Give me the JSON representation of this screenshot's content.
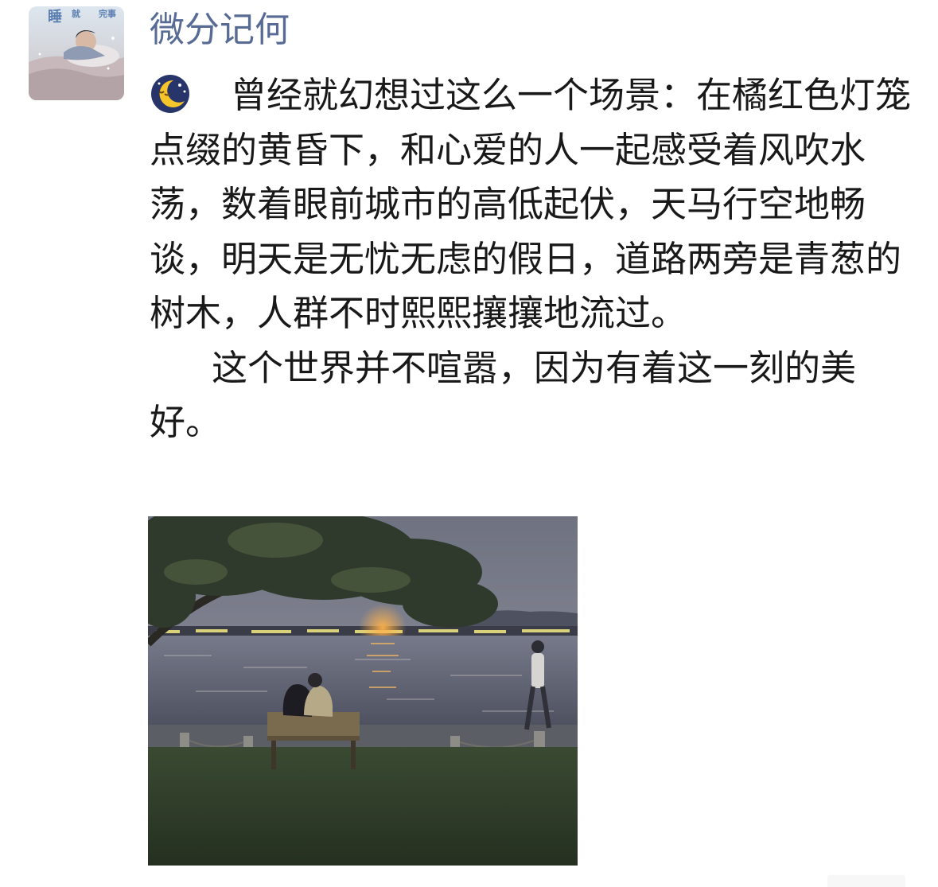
{
  "post": {
    "author": "微分记何",
    "avatar_text": {
      "left": "睡",
      "mid": "就",
      "right": "完事"
    },
    "emoji_icon": "crescent-moon-sleepy-face-icon",
    "paragraph1": "曾经就幻想过这么一个场景：在橘红色灯笼点缀的黄昏下，和心爱的人一起感受着风吹水荡，数着眼前城市的高低起伏，天马行空地畅谈，明天是无忧无虑的假日，道路两旁是青葱的树木，人群不时熙熙攘攘地流过。",
    "paragraph2": "这个世界并不喧嚣，因为有着这一刻的美好。",
    "photo_alt": "couple on a lakeside bench at dusk",
    "timestamp": "",
    "colors": {
      "author": "#576b95",
      "text": "#191919",
      "meta": "#b2b2b2"
    }
  }
}
